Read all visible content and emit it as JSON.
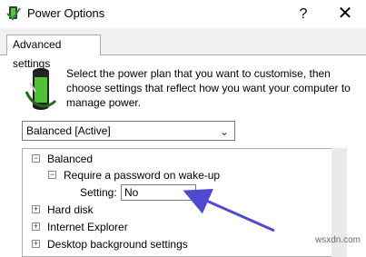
{
  "window": {
    "title": "Power Options",
    "help_label": "?",
    "close_label": "✕"
  },
  "tabs": [
    {
      "label": "Advanced settings"
    }
  ],
  "panel": {
    "description": "Select the power plan that you want to customise, then choose settings that reflect how you want your computer to manage power.",
    "plan_select": {
      "value": "Balanced [Active]",
      "chevron": "⌄"
    }
  },
  "tree": {
    "items": [
      {
        "label": "Balanced",
        "expander": "−"
      },
      {
        "label": "Require a password on wake-up",
        "expander": "−"
      },
      {
        "label": "Hard disk",
        "expander": "+"
      },
      {
        "label": "Internet Explorer",
        "expander": "+"
      },
      {
        "label": "Desktop background settings",
        "expander": "+"
      }
    ],
    "setting": {
      "label": "Setting:",
      "value": "No",
      "chevron": "⌄"
    }
  },
  "annotation": {
    "color": "#4f4ad1"
  },
  "watermark": "wsxdn.com"
}
